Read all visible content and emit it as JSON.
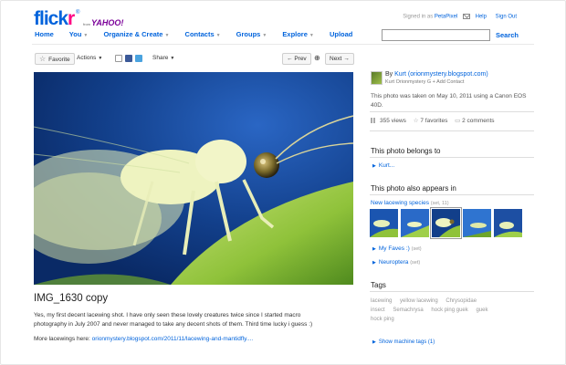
{
  "header": {
    "logo": {
      "word_blue": "flick",
      "word_pink": "r",
      "reg": "®",
      "from": "from",
      "yahoo": "YAHOO!"
    },
    "signed_in_prefix": "Signed in as",
    "username": "PetaPixel",
    "help": "Help",
    "sign_out": "Sign Out",
    "search_button": "Search",
    "search_placeholder": ""
  },
  "nav": {
    "items": [
      "Home",
      "You",
      "Organize & Create",
      "Contacts",
      "Groups",
      "Explore",
      "Upload"
    ]
  },
  "toolbar": {
    "favorite": "Favorite",
    "actions": "Actions",
    "share": "Share",
    "prev": "Prev",
    "next": "Next"
  },
  "photo": {
    "title": "IMG_1630 copy",
    "description": "Yes, my first decent lacewing shot. I have only seen these lovely creatures twice since I started macro photography in July 2007 and never managed to take any decent shots of them. Third time lucky i guess :)",
    "more_prefix": "More lacewings here:",
    "more_link": "orionmystery.blogspot.com/2011/11/lacewing-and-mantidfly...."
  },
  "owner": {
    "by_label": "By",
    "name": "Kurt (orionmystery.blogspot.com)",
    "subline": "Kurt Orionmystery G   + Add Contact",
    "taken": "This photo was taken on May 10, 2011 using a Canon EOS 40D.",
    "views": "355 views",
    "favorites": "7 favorites",
    "comments": "2 comments"
  },
  "belongs": {
    "title": "This photo belongs to",
    "link": "Kurt..."
  },
  "appears": {
    "title": "This photo also appears in",
    "set_name": "New lacewing species",
    "set_count": "(set, 11)",
    "faves": "My Faves :)",
    "faves_count": "(set)",
    "neuroptera": "Neuroptera",
    "neuroptera_count": "(set)"
  },
  "tags": {
    "title": "Tags",
    "items": [
      "lacewing",
      "yellow lacewing",
      "Chrysopidae",
      "insect",
      "Semachrysa",
      "hock ping guek",
      "guek hock ping"
    ],
    "machine": "Show machine tags (1)"
  },
  "colors": {
    "flickr_blue": "#0063dc",
    "flickr_pink": "#ff0084",
    "yahoo_purple": "#7b0099",
    "photo_background": "#0f3b82",
    "leaf_green": "#8fc23a"
  }
}
